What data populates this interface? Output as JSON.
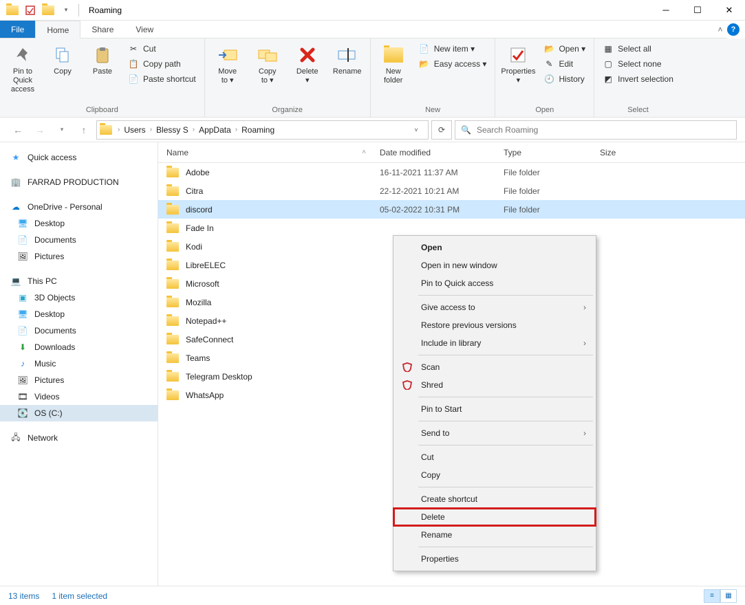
{
  "title": "Roaming",
  "menubar": {
    "file": "File",
    "home": "Home",
    "share": "Share",
    "view": "View"
  },
  "ribbon": {
    "clipboard": {
      "label": "Clipboard",
      "pin": "Pin to Quick\naccess",
      "copy": "Copy",
      "paste": "Paste",
      "cut": "Cut",
      "copypath": "Copy path",
      "pasteshortcut": "Paste shortcut"
    },
    "organize": {
      "label": "Organize",
      "moveto": "Move\nto ▾",
      "copyto": "Copy\nto ▾",
      "delete": "Delete\n▾",
      "rename": "Rename"
    },
    "new": {
      "label": "New",
      "newfolder": "New\nfolder",
      "newitem": "New item ▾",
      "easyaccess": "Easy access ▾"
    },
    "open": {
      "label": "Open",
      "properties": "Properties\n▾",
      "open": "Open ▾",
      "edit": "Edit",
      "history": "History"
    },
    "select": {
      "label": "Select",
      "all": "Select all",
      "none": "Select none",
      "invert": "Invert selection"
    }
  },
  "breadcrumb": [
    "Users",
    "Blessy S",
    "AppData",
    "Roaming"
  ],
  "search_placeholder": "Search Roaming",
  "sidebar": {
    "quickaccess": "Quick access",
    "farrad": "FARRAD PRODUCTION",
    "onedrive": "OneDrive - Personal",
    "od_items": [
      "Desktop",
      "Documents",
      "Pictures"
    ],
    "thispc": "This PC",
    "pc_items": [
      "3D Objects",
      "Desktop",
      "Documents",
      "Downloads",
      "Music",
      "Pictures",
      "Videos",
      "OS (C:)"
    ],
    "network": "Network"
  },
  "columns": {
    "name": "Name",
    "date": "Date modified",
    "type": "Type",
    "size": "Size"
  },
  "files": [
    {
      "name": "Adobe",
      "date": "16-11-2021 11:37 AM",
      "type": "File folder"
    },
    {
      "name": "Citra",
      "date": "22-12-2021 10:21 AM",
      "type": "File folder"
    },
    {
      "name": "discord",
      "date": "05-02-2022 10:31 PM",
      "type": "File folder",
      "selected": true
    },
    {
      "name": "Fade In",
      "date": "",
      "type": ""
    },
    {
      "name": "Kodi",
      "date": "",
      "type": ""
    },
    {
      "name": "LibreELEC",
      "date": "",
      "type": ""
    },
    {
      "name": "Microsoft",
      "date": "",
      "type": ""
    },
    {
      "name": "Mozilla",
      "date": "",
      "type": ""
    },
    {
      "name": "Notepad++",
      "date": "",
      "type": ""
    },
    {
      "name": "SafeConnect",
      "date": "",
      "type": ""
    },
    {
      "name": "Teams",
      "date": "",
      "type": ""
    },
    {
      "name": "Telegram Desktop",
      "date": "",
      "type": ""
    },
    {
      "name": "WhatsApp",
      "date": "",
      "type": ""
    }
  ],
  "status": {
    "count": "13 items",
    "selected": "1 item selected"
  },
  "context": [
    {
      "label": "Open",
      "bold": true
    },
    {
      "label": "Open in new window"
    },
    {
      "label": "Pin to Quick access"
    },
    {
      "sep": true
    },
    {
      "label": "Give access to",
      "sub": true
    },
    {
      "label": "Restore previous versions"
    },
    {
      "label": "Include in library",
      "sub": true
    },
    {
      "sep": true
    },
    {
      "label": "Scan",
      "icon": "shield"
    },
    {
      "label": "Shred",
      "icon": "shield"
    },
    {
      "sep": true
    },
    {
      "label": "Pin to Start"
    },
    {
      "sep": true
    },
    {
      "label": "Send to",
      "sub": true
    },
    {
      "sep": true
    },
    {
      "label": "Cut"
    },
    {
      "label": "Copy"
    },
    {
      "sep": true
    },
    {
      "label": "Create shortcut"
    },
    {
      "label": "Delete",
      "hl": true
    },
    {
      "label": "Rename"
    },
    {
      "sep": true
    },
    {
      "label": "Properties"
    }
  ]
}
